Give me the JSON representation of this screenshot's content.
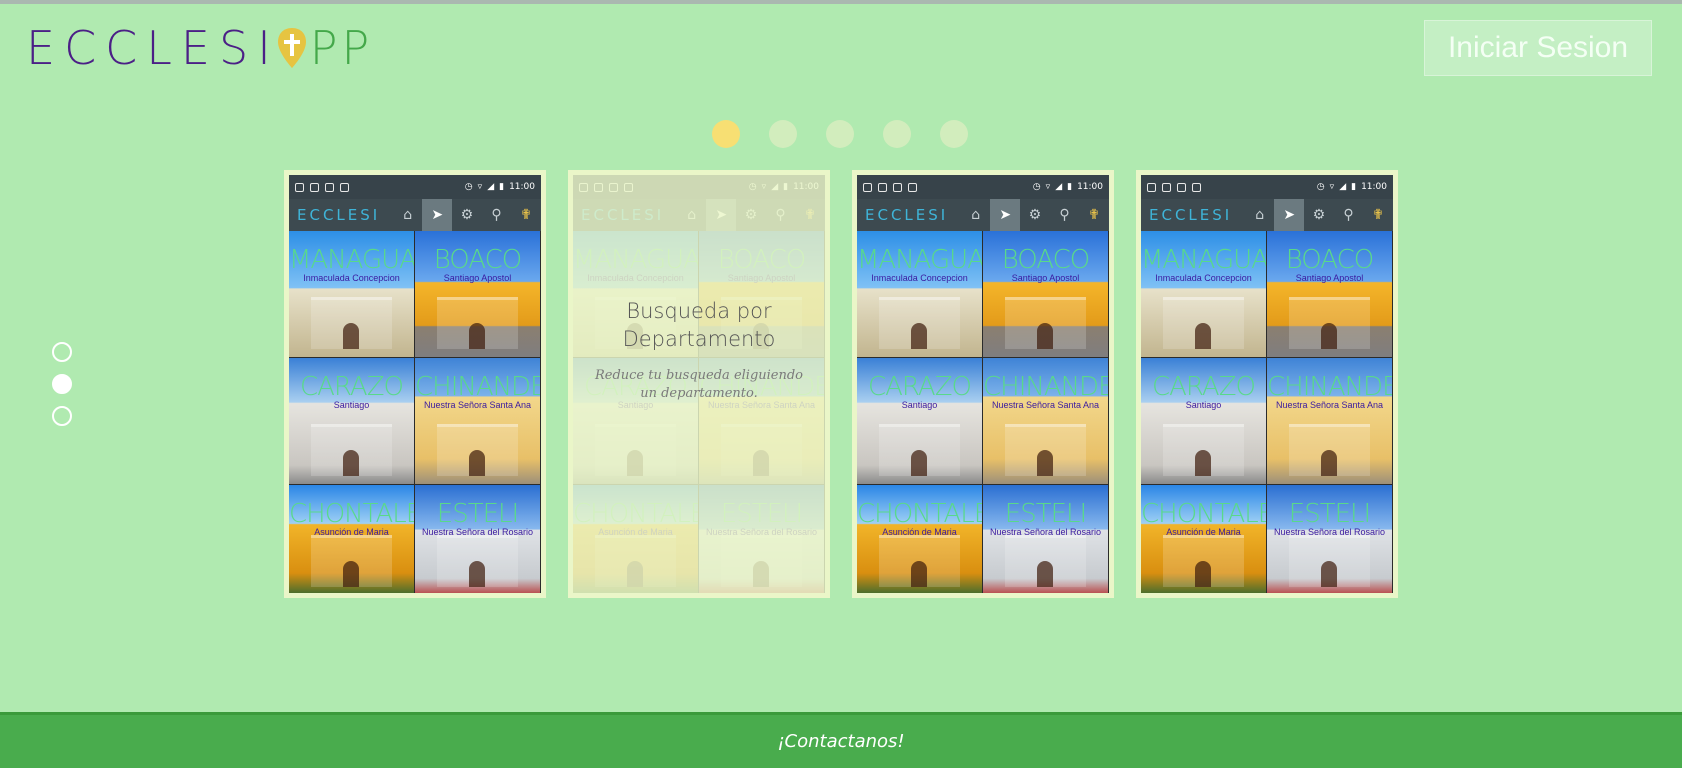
{
  "header": {
    "logo_text_start": "ECCLESI",
    "logo_text_end": "PP",
    "login_label": "Iniciar Sesion"
  },
  "carousel": {
    "dots": [
      {
        "active": true
      },
      {
        "active": false
      },
      {
        "active": false
      },
      {
        "active": false
      },
      {
        "active": false
      }
    ]
  },
  "side_nav": {
    "dots": [
      {
        "filled": false
      },
      {
        "filled": true
      },
      {
        "filled": false
      }
    ]
  },
  "phone": {
    "time": "11:00",
    "brand": "ECCLESI",
    "tiles": [
      {
        "name": "MANAGUA",
        "sub": "Inmaculada Concepcion"
      },
      {
        "name": "BOACO",
        "sub": "Santiago Apostol"
      },
      {
        "name": "CARAZO",
        "sub": "Santiago"
      },
      {
        "name": "CHINANDEGA",
        "sub": "Nuestra Señora Santa Ana"
      },
      {
        "name": "CHONTALES",
        "sub": "Asunción de Maria"
      },
      {
        "name": "ESTELI",
        "sub": "Nuestra Señora del Rosario"
      }
    ]
  },
  "overlay": {
    "title": "Busqueda por Departamento",
    "description": "Reduce tu busqueda eliguiendo un departamento."
  },
  "footer": {
    "contact_label": "¡Contactanos!"
  }
}
